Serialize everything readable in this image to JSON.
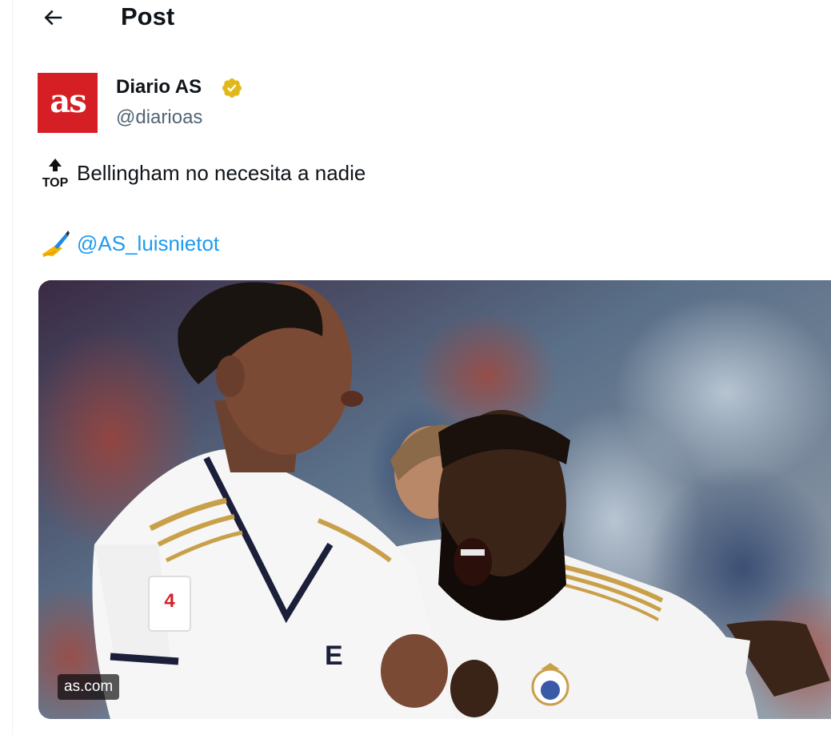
{
  "header": {
    "title": "Post",
    "back_icon": "arrow-left-icon"
  },
  "author": {
    "avatar_text": "as",
    "avatar_color": "#d51f25",
    "name": "Diario AS",
    "handle": "@diarioas",
    "verified_color": "#e2b719"
  },
  "post": {
    "line1_emoji": "top-arrow-emoji",
    "line1_text": "Bellingham no necesita a nadie",
    "line2_emoji": "writing-hand-emoji",
    "mention": "@AS_luisnietot"
  },
  "media": {
    "source": "as.com"
  },
  "colors": {
    "link": "#1d9bf0",
    "secondary_text": "#536471"
  }
}
